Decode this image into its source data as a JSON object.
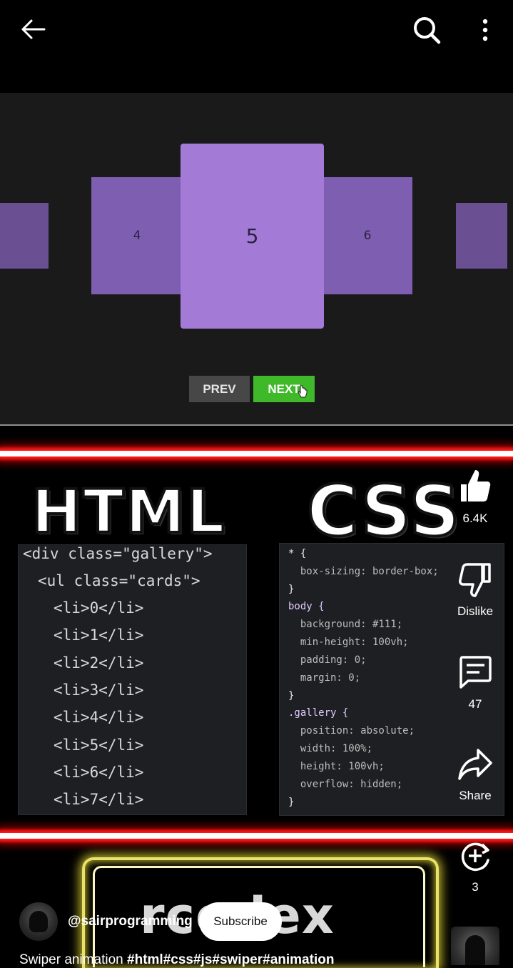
{
  "topbar": {
    "back": "back-arrow-icon",
    "search": "search-icon",
    "more": "more-vert-icon"
  },
  "preview": {
    "cards": [
      "4",
      "5",
      "6"
    ],
    "prev_label": "PREV",
    "next_label": "NEXT",
    "card_color": "#a37bd6",
    "next_color": "#3fb82a"
  },
  "overlay": {
    "left_word": "HTML",
    "right_word": "CSS",
    "html_code": [
      "<div class=\"gallery\">",
      "<ul class=\"cards\">",
      "<li>0</li>",
      "<li>1</li>",
      "<li>2</li>",
      "<li>3</li>",
      "<li>4</li>",
      "<li>5</li>",
      "<li>6</li>",
      "<li>7</li>"
    ],
    "css_code": [
      "* {",
      "  box-sizing: border-box;",
      "}",
      "body {",
      "  background: #111;",
      "  min-height: 100vh;",
      "  padding: 0;",
      "  margin: 0;",
      "}",
      ".gallery {",
      "  position: absolute;",
      "  width: 100%;",
      "  height: 100vh;",
      "  overflow: hidden;",
      "}"
    ],
    "bottom_word": "rcodex"
  },
  "actions": {
    "like_count": "6.4K",
    "dislike_label": "Dislike",
    "comment_count": "47",
    "share_label": "Share",
    "remix_count": "3"
  },
  "channel": {
    "handle": "@sairprogramming",
    "subscribe_label": "Subscribe",
    "title": "Swiper animation",
    "hashtags": "#html#css#js#swiper#animation"
  }
}
